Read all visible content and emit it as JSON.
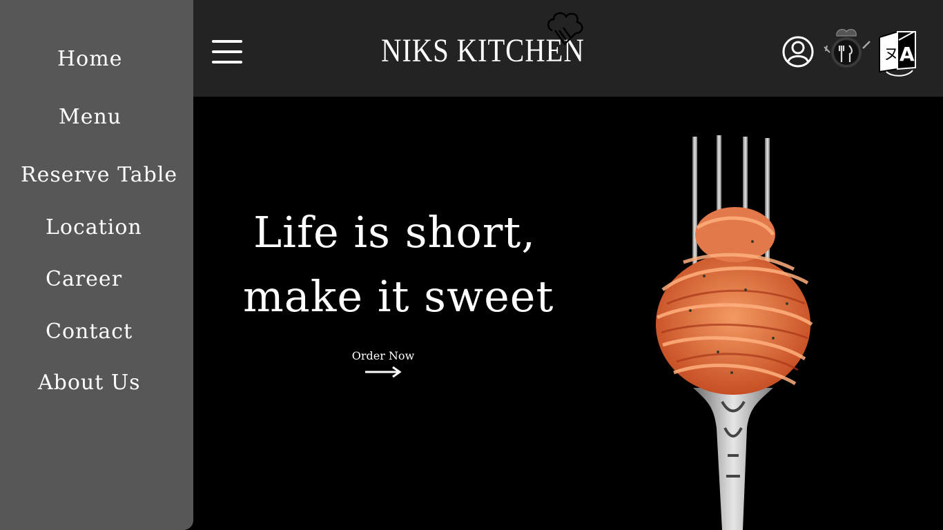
{
  "sidebar": {
    "items": [
      {
        "label": "Home"
      },
      {
        "label": "Menu"
      },
      {
        "label": "Reserve Table"
      },
      {
        "label": "Location"
      },
      {
        "label": "Career"
      },
      {
        "label": "Contact"
      },
      {
        "label": "About Us"
      }
    ]
  },
  "header": {
    "brand": "NIKS KITCHEN",
    "icons": [
      "menu-icon",
      "user-icon",
      "chef-cutlery-icon",
      "translate-icon"
    ]
  },
  "hero": {
    "line1": "Life is short,",
    "line2": "make it sweet",
    "cta_label": "Order Now"
  },
  "colors": {
    "sidebar_bg": "#575757",
    "topbar_bg": "#232323",
    "hero_bg": "#000000",
    "text": "#ffffff"
  }
}
